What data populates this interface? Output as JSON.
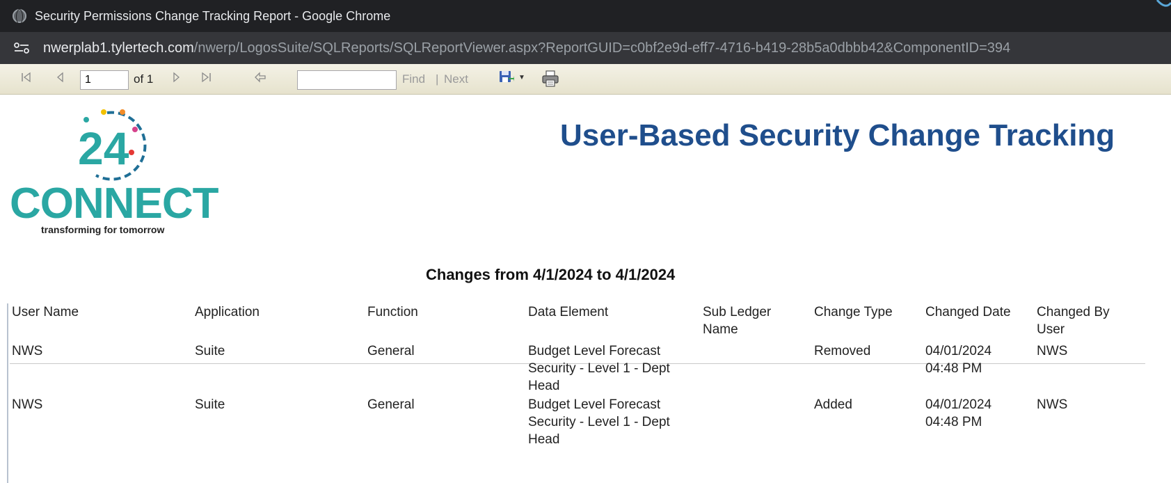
{
  "window": {
    "title": "Security Permissions Change Tracking Report - Google Chrome"
  },
  "address_bar": {
    "host": "nwerplab1.tylertech.com",
    "path": "/nwerp/LogosSuite/SQLReports/SQLReportViewer.aspx?ReportGUID=c0bf2e9d-eff7-4716-b419-28b5a0dbbb42&ComponentID=394"
  },
  "toolbar": {
    "page_value": "1",
    "of_label": "of 1",
    "find_label": "Find",
    "separator": "|",
    "next_label": "Next",
    "find_value": ""
  },
  "report": {
    "logo_number": "24",
    "logo_word": "CONNECT",
    "logo_tagline": "transforming for tomorrow",
    "title": "User-Based Security Change Tracking",
    "date_range": "Changes from 4/1/2024 to 4/1/2024",
    "columns": [
      "User Name",
      "Application",
      "Function",
      "Data Element",
      "Sub Ledger Name",
      "Change Type",
      "Changed Date",
      "Changed By User"
    ],
    "rows": [
      {
        "user_name": "NWS",
        "application": "Suite",
        "function": "General",
        "data_element": "Budget Level Forecast Security - Level 1 - Dept Head",
        "sub_ledger": "",
        "change_type": "Removed",
        "changed_date": "04/01/2024 04:48 PM",
        "changed_by": "NWS"
      },
      {
        "user_name": "NWS",
        "application": "Suite",
        "function": "General",
        "data_element": "Budget Level Forecast Security - Level 1 - Dept Head",
        "sub_ledger": "",
        "change_type": "Added",
        "changed_date": "04/01/2024 04:48 PM",
        "changed_by": "NWS"
      }
    ]
  },
  "colors": {
    "title_blue": "#1f4e8c",
    "logo_teal": "#2aa7a3",
    "chrome_dark": "#202124",
    "toolbar_beige": "#ece9d8"
  }
}
